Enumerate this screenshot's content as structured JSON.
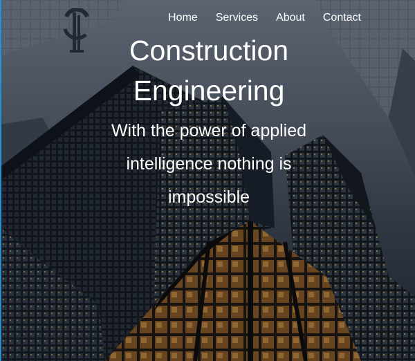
{
  "nav": {
    "items": [
      {
        "label": "Home"
      },
      {
        "label": "Services"
      },
      {
        "label": "About"
      },
      {
        "label": "Contact"
      }
    ]
  },
  "hero": {
    "title_line1": "Construction",
    "title_line2": "Engineering",
    "tagline": "With the power of applied intelligence nothing is impossible"
  },
  "colors": {
    "text": "#ffffff",
    "accent_edge": "#2b8fd6"
  },
  "icons": {
    "logo": "logo-icon"
  }
}
